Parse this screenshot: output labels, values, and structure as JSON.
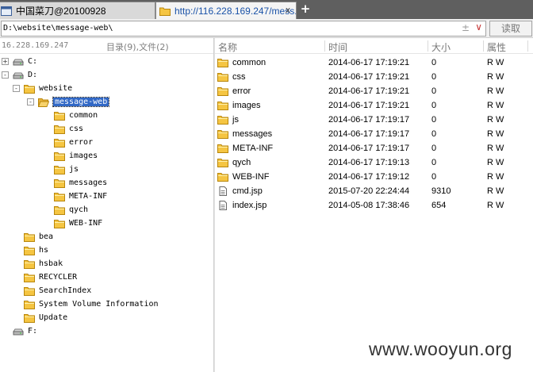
{
  "tabs": [
    {
      "label": "中国菜刀@20100928",
      "active": false
    },
    {
      "label": "http://116.228.169.247/mess...",
      "active": true
    }
  ],
  "tab_close_glyph": "x",
  "add_tab_glyph": "+",
  "address": {
    "path": "D:\\website\\message-web\\",
    "add_glyph": "±",
    "dropdown_glyph": "∨",
    "read_button": "读取"
  },
  "status": {
    "ip": "16.228.169.247",
    "count": "目录(9),文件(2)"
  },
  "tree": [
    {
      "label": "C:",
      "type": "drive",
      "level": 0,
      "expander": "+"
    },
    {
      "label": "D:",
      "type": "drive",
      "level": 0,
      "expander": "-"
    },
    {
      "label": "website",
      "type": "folder",
      "level": 1,
      "expander": "-"
    },
    {
      "label": "message-web",
      "type": "folder-open",
      "level": 2,
      "expander": "-",
      "selected": true
    },
    {
      "label": "common",
      "type": "folder",
      "level": 3
    },
    {
      "label": "css",
      "type": "folder",
      "level": 3
    },
    {
      "label": "error",
      "type": "folder",
      "level": 3
    },
    {
      "label": "images",
      "type": "folder",
      "level": 3
    },
    {
      "label": "js",
      "type": "folder",
      "level": 3
    },
    {
      "label": "messages",
      "type": "folder",
      "level": 3
    },
    {
      "label": "META-INF",
      "type": "folder",
      "level": 3
    },
    {
      "label": "qych",
      "type": "folder",
      "level": 3
    },
    {
      "label": "WEB-INF",
      "type": "folder",
      "level": 3
    },
    {
      "label": "bea",
      "type": "folder",
      "level": 1
    },
    {
      "label": "hs",
      "type": "folder",
      "level": 1
    },
    {
      "label": "hsbak",
      "type": "folder",
      "level": 1
    },
    {
      "label": "RECYCLER",
      "type": "folder",
      "level": 1
    },
    {
      "label": "SearchIndex",
      "type": "folder",
      "level": 1
    },
    {
      "label": "System Volume Information",
      "type": "folder",
      "level": 1
    },
    {
      "label": "Update",
      "type": "folder",
      "level": 1
    },
    {
      "label": "F:",
      "type": "drive",
      "level": 0
    }
  ],
  "list": {
    "headers": [
      "名称",
      "时间",
      "大小",
      "属性"
    ],
    "rows": [
      {
        "name": "common",
        "time": "2014-06-17 17:19:21",
        "size": "0",
        "attr": "R W",
        "type": "folder"
      },
      {
        "name": "css",
        "time": "2014-06-17 17:19:21",
        "size": "0",
        "attr": "R W",
        "type": "folder"
      },
      {
        "name": "error",
        "time": "2014-06-17 17:19:21",
        "size": "0",
        "attr": "R W",
        "type": "folder"
      },
      {
        "name": "images",
        "time": "2014-06-17 17:19:21",
        "size": "0",
        "attr": "R W",
        "type": "folder"
      },
      {
        "name": "js",
        "time": "2014-06-17 17:19:17",
        "size": "0",
        "attr": "R W",
        "type": "folder"
      },
      {
        "name": "messages",
        "time": "2014-06-17 17:19:17",
        "size": "0",
        "attr": "R W",
        "type": "folder"
      },
      {
        "name": "META-INF",
        "time": "2014-06-17 17:19:17",
        "size": "0",
        "attr": "R W",
        "type": "folder"
      },
      {
        "name": "qych",
        "time": "2014-06-17 17:19:13",
        "size": "0",
        "attr": "R W",
        "type": "folder"
      },
      {
        "name": "WEB-INF",
        "time": "2014-06-17 17:19:12",
        "size": "0",
        "attr": "R W",
        "type": "folder"
      },
      {
        "name": "cmd.jsp",
        "time": "2015-07-20 22:24:44",
        "size": "9310",
        "attr": "R W",
        "type": "file"
      },
      {
        "name": "index.jsp",
        "time": "2014-05-08 17:38:46",
        "size": "654",
        "attr": "R W",
        "type": "file"
      }
    ]
  },
  "watermark": "www.wooyun.org",
  "colors": {
    "selection": "#3168c6",
    "folder": "#f5c542",
    "link": "#1a52a8"
  }
}
